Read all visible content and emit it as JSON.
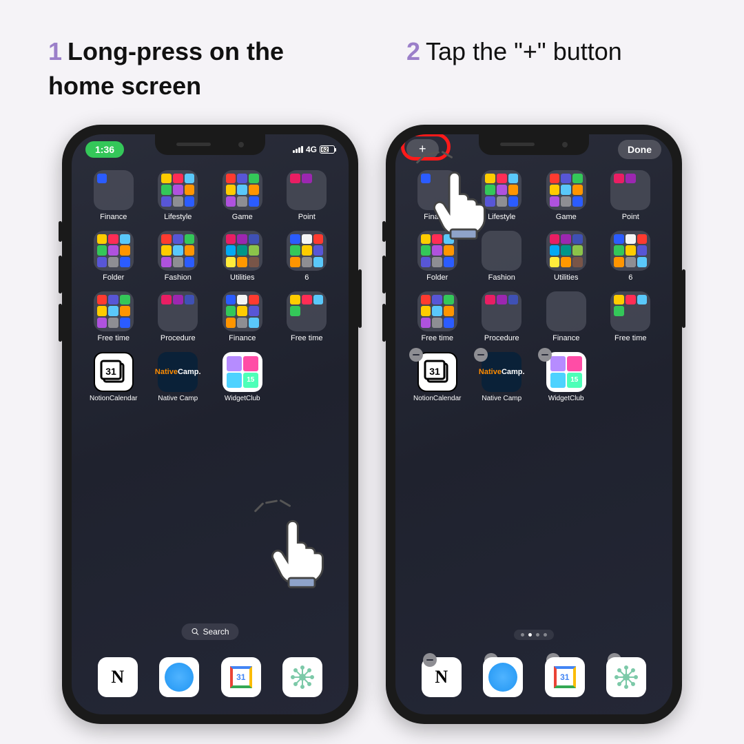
{
  "steps": [
    {
      "num": "1",
      "text": "Long-press on the home screen"
    },
    {
      "num": "2",
      "text": "Tap the \"+\" button"
    }
  ],
  "status": {
    "time": "1:36",
    "network": "4G",
    "battery": "62"
  },
  "edit_bar": {
    "plus": "+",
    "done": "Done"
  },
  "folders_row1": [
    {
      "label": "Finance"
    },
    {
      "label": "Lifestyle"
    },
    {
      "label": "Game"
    },
    {
      "label": "Point"
    }
  ],
  "folders_row2": [
    {
      "label": "Folder"
    },
    {
      "label": "Fashion"
    },
    {
      "label": "Utilities"
    },
    {
      "label": "6"
    }
  ],
  "folders_row3": [
    {
      "label": "Free time"
    },
    {
      "label": "Procedure"
    },
    {
      "label": "Finance"
    },
    {
      "label": "Free time"
    }
  ],
  "apps": [
    {
      "label": "NotionCalendar",
      "icon_text": "31"
    },
    {
      "label": "Native Camp",
      "icon_line1": "Native",
      "icon_line2": "Camp."
    },
    {
      "label": "WidgetClub",
      "cal_day": "15"
    }
  ],
  "gcal_day": "31",
  "search": "Search",
  "notion_letter": "N",
  "mini_colors_a": [
    "#2b5cff",
    "#f5f5f5",
    "#ff3b30",
    "#34c759",
    "#ffcc00",
    "#5856d6",
    "#ff9500",
    "#8e8e93",
    "#5ac8fa"
  ],
  "mini_colors_b": [
    "#ffcc00",
    "#ff2d55",
    "#5ac8fa",
    "#34c759",
    "#af52de",
    "#ff9500",
    "#5856d6",
    "#8e8e93",
    "#2b5cff"
  ],
  "mini_colors_c": [
    "#ff3b30",
    "#5856d6",
    "#34c759",
    "#ffcc00",
    "#5ac8fa",
    "#ff9500",
    "#af52de",
    "#8e8e93",
    "#2b5cff"
  ],
  "mini_colors_d": [
    "#e91e63",
    "#9c27b0",
    "#3f51b5",
    "#03a9f4",
    "#009688",
    "#8bc34a",
    "#ffeb3b",
    "#ff9800",
    "#795548"
  ]
}
